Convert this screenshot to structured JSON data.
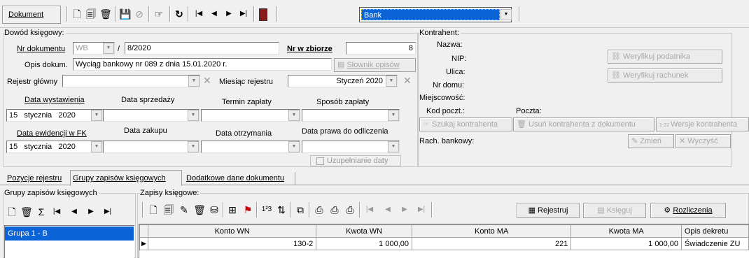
{
  "toolbar": {
    "document_label": "Dokument",
    "bank_select_value": "Bank"
  },
  "dowod": {
    "section_title": "Dowód księgowy:",
    "nr_dokumentu_label": "Nr dokumentu",
    "nr_prefix": "WB",
    "slash": "/",
    "nr_value": "8/2020",
    "nr_w_zbiorze_label": "Nr w zbiorze",
    "nr_w_zbiorze_value": "8",
    "opis_label": "Opis dokum.",
    "opis_value": "Wyciąg bankowy nr 089 z dnia 15.01.2020 r.",
    "slownik_button": "Słownik opisów",
    "rejestr_label": "Rejestr główny",
    "rejestr_value": "",
    "miesiac_label": "Miesiąc rejestru",
    "miesiac_value": "Styczeń 2020",
    "data_wystawienia_label": "Data wystawienia",
    "data_sprzedazy_label": "Data sprzedaży",
    "termin_zaplaty_label": "Termin zapłaty",
    "sposob_zaplaty_label": "Sposób zapłaty",
    "data_wystawienia_day": "15",
    "data_wystawienia_month": "stycznia",
    "data_wystawienia_year": "2020",
    "data_ewidencji_label": "Data ewidencji w FK",
    "data_zakupu_label": "Data zakupu",
    "data_otrzymania_label": "Data otrzymania",
    "data_prawa_label": "Data prawa do odliczenia",
    "data_ewidencji_day": "15",
    "data_ewidencji_month": "stycznia",
    "data_ewidencji_year": "2020",
    "uzupelnianie_label": "Uzupełnianie daty"
  },
  "kontrahent": {
    "title": "Kontrahent:",
    "nazwa_label": "Nazwa:",
    "nip_label": "NIP:",
    "ulica_label": "Ulica:",
    "nr_domu_label": "Nr domu:",
    "miejscowosc_label": "Miejscowość:",
    "kod_label": "Kod poczt.:",
    "poczta_label": "Poczta:",
    "weryfikuj_podatnika": "Weryfikuj podatnika",
    "weryfikuj_rachunek": "Weryfikuj rachunek",
    "szukaj": "Szukaj kontrahenta",
    "usun": "Usuń kontrahenta z dokumentu",
    "wersje": "Wersje kontrahenta",
    "rach_label": "Rach. bankowy:",
    "zmien": "Zmień",
    "wyczysc": "Wyczyść"
  },
  "tabs": [
    {
      "label": "Pozycje rejestru"
    },
    {
      "label": "Grupy zapisów księgowych"
    },
    {
      "label": "Dodatkowe dane dokumentu"
    }
  ],
  "grupy": {
    "title": "Grupy zapisów księgowych",
    "items": [
      "Grupa 1 - B"
    ]
  },
  "zapisy": {
    "title": "Zapisy księgowe:",
    "rejestruj": "Rejestruj",
    "ksieguj": "Księguj",
    "rozliczenia": "Rozliczenia",
    "columns": [
      "Konto WN",
      "Kwota WN",
      "Konto MA",
      "Kwota MA",
      "Opis dekretu"
    ],
    "rows": [
      {
        "konto_wn": "130-2",
        "kwota_wn": "1 000,00",
        "konto_ma": "221",
        "kwota_ma": "1 000,00",
        "opis": "Świadczenie ZU"
      }
    ]
  },
  "colors": {
    "selection": "#0a64d8",
    "doc_icon": "#8b1a1a"
  }
}
